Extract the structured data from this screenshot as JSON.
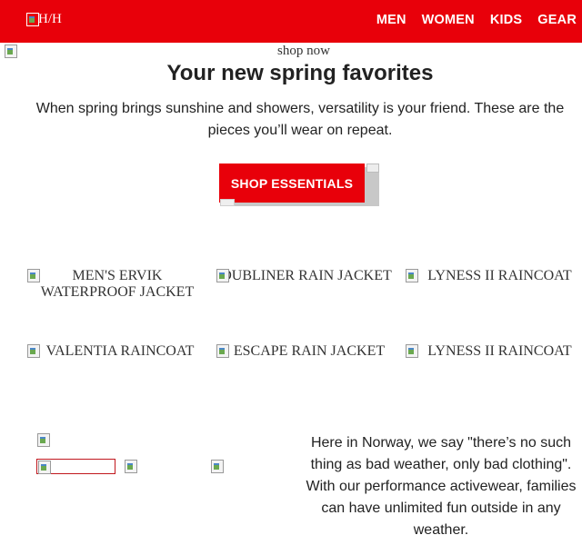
{
  "header": {
    "logo_alt": "H/H",
    "nav": [
      "MEN",
      "WOMEN",
      "KIDS",
      "GEAR"
    ]
  },
  "hero": {
    "image_alt": "shop now",
    "title": "Your new spring favorites",
    "subtitle": "When spring brings sunshine and showers, versatility is your friend. These are the pieces you’ll wear on repeat.",
    "cta_label": "SHOP ESSENTIALS"
  },
  "products": [
    {
      "name": "MEN'S ERVIK WATERPROOF JACKET"
    },
    {
      "name": "DUBLINER RAIN JACKET"
    },
    {
      "name": "LYNESS II RAINCOAT"
    },
    {
      "name": "VALENTIA RAINCOAT"
    },
    {
      "name": "ESCAPE RAIN JACKET"
    },
    {
      "name": "LYNESS II RAINCOAT"
    }
  ],
  "story": {
    "text": "Here in Norway, we say \"there’s no such thing as bad weather, only bad clothing\". With our performance activewear, families can have unlimited fun outside in any weather."
  },
  "colors": {
    "brand_red": "#e8000a",
    "button_shadow": "#c8c8c8",
    "text": "#222222"
  }
}
